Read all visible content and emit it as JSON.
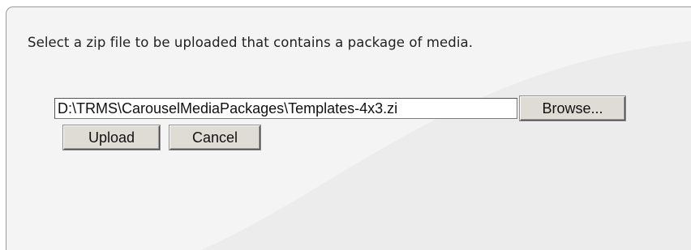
{
  "dialog": {
    "instructions": "Select a zip file to be uploaded that contains a package of media.",
    "file_input": {
      "value": "D:\\TRMS\\CarouselMediaPackages\\Templates-4x3.zi"
    },
    "browse_label": "Browse...",
    "upload_label": "Upload",
    "cancel_label": "Cancel"
  },
  "colors": {
    "panel_background": "#f4f4f4",
    "panel_shape": "#ececec",
    "panel_border": "#9a9a9a",
    "button_face": "#dedcd5"
  }
}
